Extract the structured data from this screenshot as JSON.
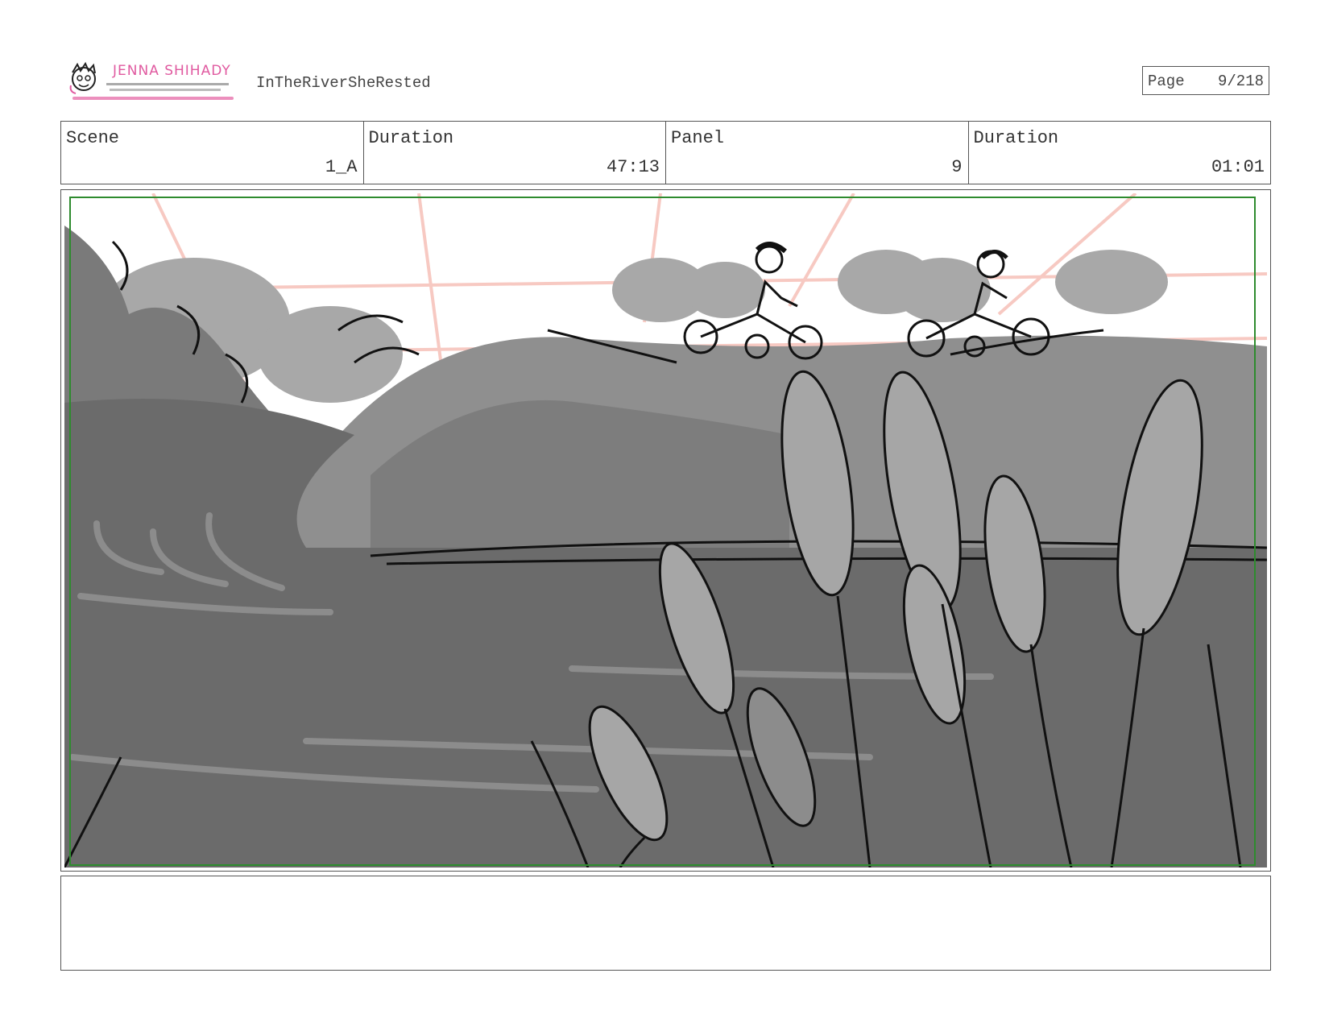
{
  "header": {
    "logo_name": "JENNA SHIHADY",
    "project_title": "InTheRiverSheRested",
    "page_label": "Page",
    "page_value": "9/218"
  },
  "info": {
    "scene_label": "Scene",
    "scene_value": "1_A",
    "scene_duration_label": "Duration",
    "scene_duration_value": "47:13",
    "panel_label": "Panel",
    "panel_value": "9",
    "panel_duration_label": "Duration",
    "panel_duration_value": "01:01"
  },
  "notes": {
    "text": ""
  },
  "colors": {
    "logo_pink": "#e05aa0",
    "safe_area_green": "#2e8b2e",
    "perspective_grid": "#f7c9c2"
  }
}
